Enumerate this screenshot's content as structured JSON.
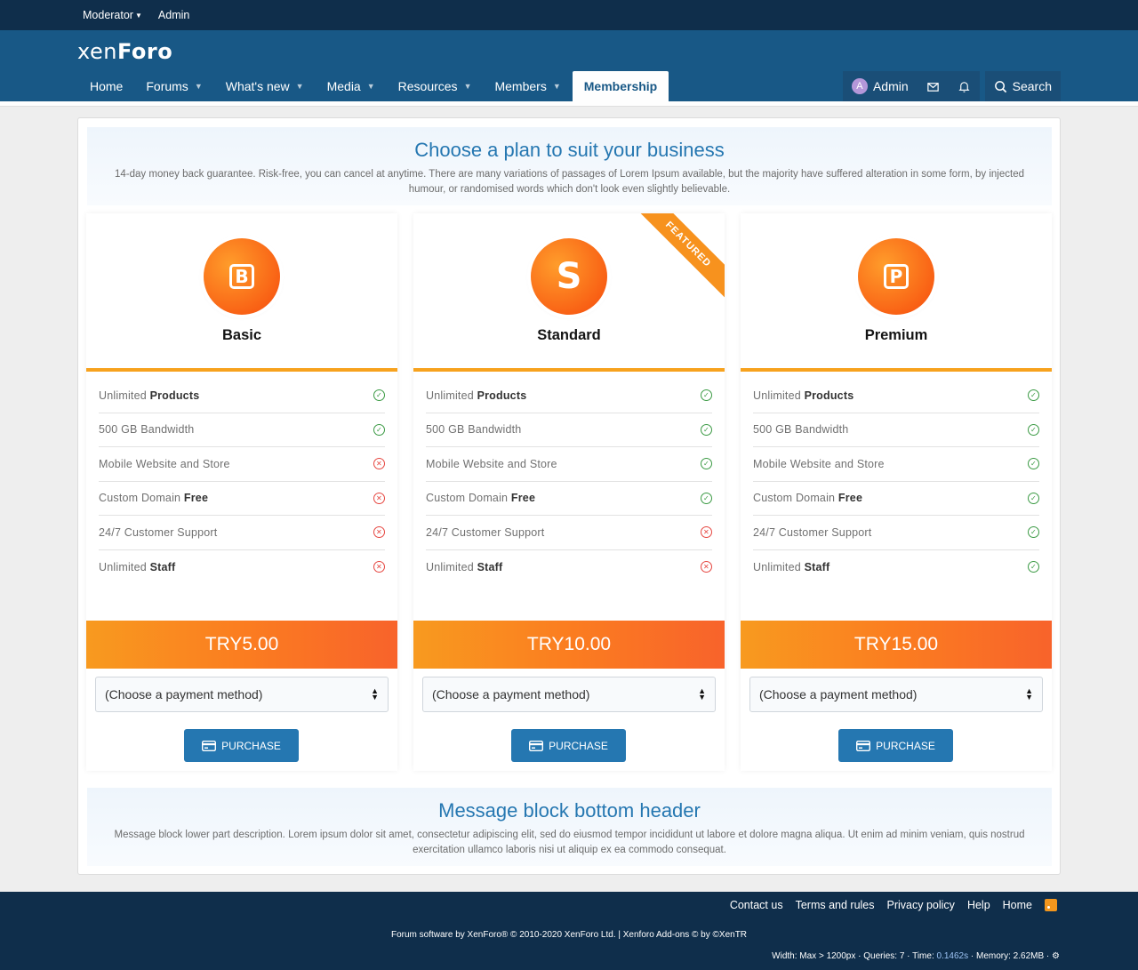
{
  "staffbar": {
    "moderator": "Moderator",
    "admin": "Admin"
  },
  "header": {
    "logo_main": "xen",
    "logo_accent": "Foro"
  },
  "nav": {
    "tabs": [
      {
        "label": "Home"
      },
      {
        "label": "Forums"
      },
      {
        "label": "What's new"
      },
      {
        "label": "Media"
      },
      {
        "label": "Resources"
      },
      {
        "label": "Members"
      },
      {
        "label": "Membership"
      }
    ],
    "user": "Admin",
    "avatar_letter": "A",
    "search": "Search"
  },
  "top_block": {
    "title": "Choose a plan to suit your business",
    "desc": "14-day money back guarantee. Risk-free, you can cancel at anytime. There are many variations of passages of Lorem Ipsum available, but the majority have suffered alteration in some form, by injected humour, or randomised words which don't look even slightly believable."
  },
  "plans": [
    {
      "letter": "B",
      "name": "Basic",
      "featured": "",
      "features": [
        {
          "pre": "Unlimited ",
          "bold": "Products",
          "ok": true
        },
        {
          "pre": "500 GB Bandwidth",
          "bold": "",
          "ok": true
        },
        {
          "pre": "Mobile Website and Store",
          "bold": "",
          "ok": false
        },
        {
          "pre": "Custom Domain ",
          "bold": "Free",
          "ok": false
        },
        {
          "pre": "24/7 Customer Support",
          "bold": "",
          "ok": false
        },
        {
          "pre": "Unlimited ",
          "bold": "Staff",
          "ok": false
        }
      ],
      "price": "TRY5.00",
      "payment_select": "(Choose a payment method)",
      "purchase": "PURCHASE"
    },
    {
      "letter": "S",
      "name": "Standard",
      "featured": "FEATURED",
      "features": [
        {
          "pre": "Unlimited ",
          "bold": "Products",
          "ok": true
        },
        {
          "pre": "500 GB Bandwidth",
          "bold": "",
          "ok": true
        },
        {
          "pre": "Mobile Website and Store",
          "bold": "",
          "ok": true
        },
        {
          "pre": "Custom Domain ",
          "bold": "Free",
          "ok": true
        },
        {
          "pre": "24/7 Customer Support",
          "bold": "",
          "ok": false
        },
        {
          "pre": "Unlimited ",
          "bold": "Staff",
          "ok": false
        }
      ],
      "price": "TRY10.00",
      "payment_select": "(Choose a payment method)",
      "purchase": "PURCHASE"
    },
    {
      "letter": "P",
      "name": "Premium",
      "featured": "",
      "features": [
        {
          "pre": "Unlimited ",
          "bold": "Products",
          "ok": true
        },
        {
          "pre": "500 GB Bandwidth",
          "bold": "",
          "ok": true
        },
        {
          "pre": "Mobile Website and Store",
          "bold": "",
          "ok": true
        },
        {
          "pre": "Custom Domain ",
          "bold": "Free",
          "ok": true
        },
        {
          "pre": "24/7 Customer Support",
          "bold": "",
          "ok": true
        },
        {
          "pre": "Unlimited ",
          "bold": "Staff",
          "ok": true
        }
      ],
      "price": "TRY15.00",
      "payment_select": "(Choose a payment method)",
      "purchase": "PURCHASE"
    }
  ],
  "bottom_block": {
    "title": "Message block bottom header",
    "desc": "Message block lower part description. Lorem ipsum dolor sit amet, consectetur adipiscing elit, sed do eiusmod tempor incididunt ut labore et dolore magna aliqua. Ut enim ad minim veniam, quis nostrud exercitation ullamco laboris nisi ut aliquip ex ea commodo consequat."
  },
  "footer": {
    "links": [
      "Contact us",
      "Terms and rules",
      "Privacy policy",
      "Help",
      "Home"
    ],
    "copyright": "Forum software by XenForo® © 2010-2020 XenForo Ltd. | Xenforo Add-ons © by ©XenTR",
    "debug_prefix": "Width: Max > 1200px · Queries: 7 · Time: ",
    "debug_time": "0.1462s",
    "debug_suffix": " · Memory: 2.62MB ·"
  },
  "colors": {
    "accent": "#2577b1",
    "header": "#185886",
    "dark": "#0f2e4b",
    "orange": "#f7a21e",
    "ok": "#3b9a44",
    "no": "#e64640"
  }
}
